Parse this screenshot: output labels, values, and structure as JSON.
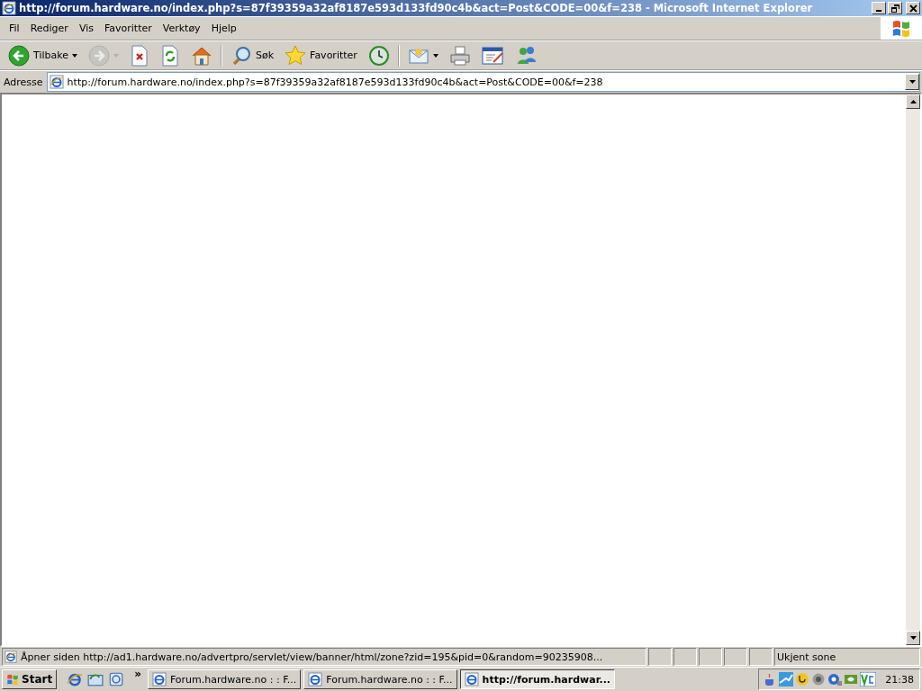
{
  "window": {
    "title": "http://forum.hardware.no/index.php?s=87f39359a32af8187e593d133fd90c4b&act=Post&CODE=00&f=238 - Microsoft Internet Explorer"
  },
  "menu": [
    "Fil",
    "Rediger",
    "Vis",
    "Favoritter",
    "Verktøy",
    "Hjelp"
  ],
  "toolbar": [
    {
      "kind": "back",
      "label": "Tilbake",
      "dropdown": true,
      "disabled": false
    },
    {
      "kind": "forward",
      "dropdown": true,
      "disabled": true
    },
    {
      "kind": "stop",
      "dropdown": false,
      "disabled": false
    },
    {
      "kind": "refresh",
      "dropdown": false,
      "disabled": false
    },
    {
      "kind": "home",
      "dropdown": false,
      "disabled": false
    },
    {
      "kind": "separator"
    },
    {
      "kind": "search",
      "label": "Søk",
      "dropdown": false,
      "disabled": false
    },
    {
      "kind": "favorites",
      "label": "Favoritter",
      "dropdown": false,
      "disabled": false
    },
    {
      "kind": "history",
      "dropdown": false,
      "disabled": false
    },
    {
      "kind": "separator"
    },
    {
      "kind": "mail",
      "dropdown": true,
      "disabled": false
    },
    {
      "kind": "print",
      "dropdown": false,
      "disabled": false
    },
    {
      "kind": "edit",
      "dropdown": false,
      "disabled": false
    },
    {
      "kind": "messenger",
      "dropdown": false,
      "disabled": false
    }
  ],
  "address_bar": {
    "label": "Adresse",
    "value": "http://forum.hardware.no/index.php?s=87f39359a32af8187e593d133fd90c4b&act=Post&CODE=00&f=238"
  },
  "status_bar": {
    "text": "Åpner siden http://ad1.hardware.no/advertpro/servlet/view/banner/html/zone?zid=195&pid=0&random=90235908...",
    "zone": "Ukjent sone"
  },
  "taskbar": {
    "start": "Start",
    "chevron": "»",
    "tasks": [
      {
        "label": "Forum.hardware.no : : F...",
        "selected": false
      },
      {
        "label": "Forum.hardware.no : : F...",
        "selected": false
      },
      {
        "label": "http://forum.hardwar...",
        "selected": true
      }
    ],
    "clock": "21:38"
  }
}
